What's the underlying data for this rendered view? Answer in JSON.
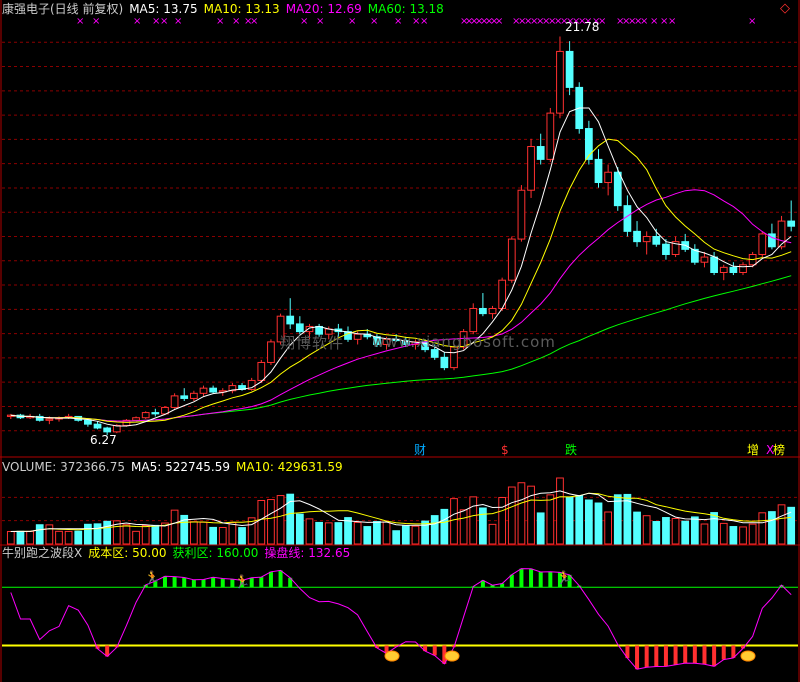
{
  "price_panel": {
    "stock_name": "康强电子(日线 前复权)",
    "ma5": {
      "label": "MA5:",
      "value": "13.75",
      "color": "#ffffff"
    },
    "ma10": {
      "label": "MA10:",
      "value": "13.13",
      "color": "#ffff00"
    },
    "ma20": {
      "label": "MA20:",
      "value": "12.69",
      "color": "#ff00ff"
    },
    "ma60": {
      "label": "MA60:",
      "value": "13.18",
      "color": "#00ff00"
    },
    "high_label": "21.78",
    "low_label": "6.27",
    "corner_icon": "diamond-icon"
  },
  "event_tags": [
    {
      "text": "财",
      "color": "#00aaff"
    },
    {
      "text": "$",
      "color": "#ff3030"
    },
    {
      "text": "跌",
      "color": "#00ff00"
    },
    {
      "text": "增",
      "color": "#ffff00"
    },
    {
      "text": "X",
      "color": "#ff00ff"
    },
    {
      "text": "榜",
      "color": "#ffff00"
    }
  ],
  "watermark": {
    "cn": "翔博软件",
    "url": "www.xiangbosoft.com"
  },
  "volume_panel": {
    "label": "VOLUME:",
    "value": "372366.75",
    "ma5_label": "MA5:",
    "ma5_value": "522745.59",
    "ma10_label": "MA10:",
    "ma10_value": "429631.59"
  },
  "indicator_panel": {
    "name": "牛别跑之波段X",
    "cost_label": "成本区:",
    "cost_value": "50.00",
    "profit_label": "获利区:",
    "profit_value": "160.00",
    "trade_label": "操盘线:",
    "trade_value": "132.65"
  },
  "colors": {
    "up": "#ff3030",
    "down": "#54ffff",
    "grid": "#8b0000",
    "ma5": "#ffffff",
    "ma10": "#ffff00",
    "ma20": "#ff00ff",
    "ma60": "#00ff00",
    "trade_line": "#ff00ff",
    "cost_line": "#ffff00",
    "profit_line": "#00ff00"
  },
  "chart_data": {
    "type": "candlestick",
    "price_range": [
      5.5,
      22.5
    ],
    "candles": [
      [
        7.0,
        7.1,
        6.9,
        7.05
      ],
      [
        7.05,
        7.1,
        6.9,
        6.95
      ],
      [
        6.95,
        7.1,
        6.9,
        7.0
      ],
      [
        7.0,
        7.1,
        6.8,
        6.85
      ],
      [
        6.85,
        7.0,
        6.7,
        6.9
      ],
      [
        6.9,
        7.0,
        6.8,
        6.95
      ],
      [
        6.95,
        7.1,
        6.9,
        7.0
      ],
      [
        7.0,
        7.0,
        6.8,
        6.85
      ],
      [
        6.85,
        6.9,
        6.6,
        6.7
      ],
      [
        6.7,
        6.8,
        6.5,
        6.55
      ],
      [
        6.55,
        6.6,
        6.27,
        6.4
      ],
      [
        6.4,
        6.7,
        6.35,
        6.65
      ],
      [
        6.65,
        6.9,
        6.6,
        6.85
      ],
      [
        6.85,
        7.0,
        6.8,
        6.95
      ],
      [
        6.95,
        7.2,
        6.9,
        7.15
      ],
      [
        7.15,
        7.3,
        7.0,
        7.1
      ],
      [
        7.1,
        7.4,
        7.05,
        7.35
      ],
      [
        7.35,
        7.9,
        7.3,
        7.8
      ],
      [
        7.8,
        8.1,
        7.6,
        7.7
      ],
      [
        7.7,
        8.0,
        7.6,
        7.9
      ],
      [
        7.9,
        8.2,
        7.8,
        8.1
      ],
      [
        8.1,
        8.2,
        7.9,
        7.95
      ],
      [
        7.95,
        8.1,
        7.8,
        8.0
      ],
      [
        8.0,
        8.3,
        7.9,
        8.2
      ],
      [
        8.2,
        8.3,
        8.0,
        8.05
      ],
      [
        8.05,
        8.5,
        8.0,
        8.4
      ],
      [
        8.4,
        9.2,
        8.3,
        9.1
      ],
      [
        9.1,
        10.0,
        9.0,
        9.9
      ],
      [
        9.9,
        11.0,
        9.8,
        10.9
      ],
      [
        10.9,
        11.6,
        10.4,
        10.6
      ],
      [
        10.6,
        10.9,
        10.2,
        10.3
      ],
      [
        10.3,
        10.6,
        10.0,
        10.5
      ],
      [
        10.5,
        10.6,
        10.1,
        10.2
      ],
      [
        10.2,
        10.5,
        10.0,
        10.4
      ],
      [
        10.4,
        10.6,
        10.1,
        10.3
      ],
      [
        10.3,
        10.5,
        9.9,
        10.0
      ],
      [
        10.0,
        10.3,
        9.8,
        10.2
      ],
      [
        10.2,
        10.4,
        10.0,
        10.1
      ],
      [
        10.1,
        10.2,
        9.7,
        9.8
      ],
      [
        9.8,
        10.1,
        9.6,
        10.0
      ],
      [
        10.0,
        10.2,
        9.9,
        9.95
      ],
      [
        9.95,
        10.1,
        9.7,
        9.8
      ],
      [
        9.8,
        10.0,
        9.6,
        9.9
      ],
      [
        9.9,
        10.0,
        9.5,
        9.6
      ],
      [
        9.6,
        9.8,
        9.2,
        9.3
      ],
      [
        9.3,
        9.5,
        8.8,
        8.9
      ],
      [
        8.9,
        9.8,
        8.8,
        9.7
      ],
      [
        9.7,
        10.4,
        9.6,
        10.3
      ],
      [
        10.3,
        11.4,
        10.2,
        11.2
      ],
      [
        11.2,
        11.8,
        10.9,
        11.0
      ],
      [
        11.0,
        11.3,
        10.8,
        11.2
      ],
      [
        11.2,
        12.4,
        11.1,
        12.3
      ],
      [
        12.3,
        14.0,
        12.2,
        13.9
      ],
      [
        13.9,
        16.0,
        13.8,
        15.8
      ],
      [
        15.8,
        17.8,
        15.5,
        17.5
      ],
      [
        17.5,
        18.0,
        16.8,
        17.0
      ],
      [
        17.0,
        19.0,
        16.9,
        18.8
      ],
      [
        18.8,
        21.78,
        18.6,
        21.2
      ],
      [
        21.2,
        21.6,
        19.5,
        19.8
      ],
      [
        19.8,
        20.0,
        18.0,
        18.2
      ],
      [
        18.2,
        18.5,
        16.8,
        17.0
      ],
      [
        17.0,
        17.4,
        15.9,
        16.1
      ],
      [
        16.1,
        16.8,
        15.6,
        16.5
      ],
      [
        16.5,
        16.7,
        15.0,
        15.2
      ],
      [
        15.2,
        15.6,
        14.0,
        14.2
      ],
      [
        14.2,
        14.6,
        13.6,
        13.8
      ],
      [
        13.8,
        14.2,
        13.3,
        14.0
      ],
      [
        14.0,
        14.3,
        13.6,
        13.7
      ],
      [
        13.7,
        13.9,
        13.1,
        13.3
      ],
      [
        13.3,
        14.0,
        13.2,
        13.8
      ],
      [
        13.8,
        14.1,
        13.4,
        13.5
      ],
      [
        13.5,
        13.7,
        12.9,
        13.0
      ],
      [
        13.0,
        13.4,
        12.8,
        13.2
      ],
      [
        13.2,
        13.4,
        12.5,
        12.6
      ],
      [
        12.6,
        12.9,
        12.3,
        12.8
      ],
      [
        12.8,
        13.0,
        12.5,
        12.6
      ],
      [
        12.6,
        13.0,
        12.5,
        12.9
      ],
      [
        12.9,
        13.4,
        12.8,
        13.3
      ],
      [
        13.3,
        14.2,
        13.2,
        14.1
      ],
      [
        14.1,
        14.5,
        13.5,
        13.6
      ],
      [
        13.6,
        14.8,
        13.5,
        14.6
      ],
      [
        14.6,
        15.4,
        14.2,
        14.4
      ]
    ]
  }
}
